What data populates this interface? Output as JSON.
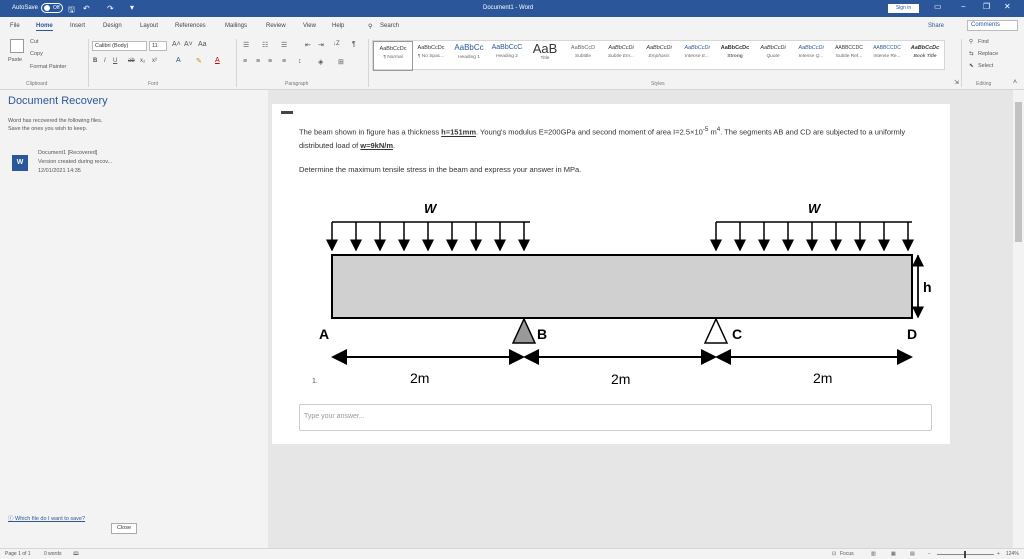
{
  "titlebar": {
    "autosave_label": "AutoSave",
    "autosave_state": "Off",
    "title": "Document1  -  Word",
    "signin": "Sign in",
    "save_icon": "save-icon",
    "undo_icon": "undo-icon",
    "redo_icon": "redo-icon",
    "customize_icon": "customize-qat-icon",
    "display_icon": "ribbon-display-icon",
    "min": "−",
    "restore": "❐",
    "close": "✕"
  },
  "tabs": [
    "File",
    "Home",
    "Insert",
    "Design",
    "Layout",
    "References",
    "Mailings",
    "Review",
    "View",
    "Help"
  ],
  "search_label": "Search",
  "share_label": "Share",
  "comments_label": "Comments",
  "ribbon": {
    "clipboard": {
      "paste": "Paste",
      "cut": "Cut",
      "copy": "Copy",
      "format_painter": "Format Painter",
      "label": "Clipboard"
    },
    "font": {
      "font_name": "Calibri (Body)",
      "font_size": "11",
      "label": "Font"
    },
    "paragraph": {
      "label": "Paragraph"
    },
    "styles": {
      "label": "Styles",
      "items": [
        {
          "sample": "AaBbCcDc",
          "name": "¶ Normal"
        },
        {
          "sample": "AaBbCcDc",
          "name": "¶ No Spac..."
        },
        {
          "sample": "AaBbCc",
          "name": "Heading 1"
        },
        {
          "sample": "AaBbCcC",
          "name": "Heading 2"
        },
        {
          "sample": "AaB",
          "name": "Title"
        },
        {
          "sample": "AaBbCcD",
          "name": "Subtitle"
        },
        {
          "sample": "AaBbCcDi",
          "name": "Subtle Em..."
        },
        {
          "sample": "AaBbCcDi",
          "name": "Emphasis"
        },
        {
          "sample": "AaBbCcDi",
          "name": "Intense E..."
        },
        {
          "sample": "AaBbCcDc",
          "name": "Strong"
        },
        {
          "sample": "AaBbCcDi",
          "name": "Quote"
        },
        {
          "sample": "AaBbCcDi",
          "name": "Intense Q..."
        },
        {
          "sample": "AABBCCDC",
          "name": "Subtle Ref..."
        },
        {
          "sample": "AABBCCDC",
          "name": "Intense Re..."
        },
        {
          "sample": "AaBbCcDc",
          "name": "Book Title"
        }
      ]
    },
    "editing": {
      "find": "Find",
      "replace": "Replace",
      "select": "Select",
      "label": "Editing"
    }
  },
  "recovery": {
    "title": "Document Recovery",
    "line1": "Word has recovered the following files.",
    "line2": "Save the ones you wish to keep.",
    "doc_name": "Document1  [Recovered]",
    "doc_desc": "Version created during recov...",
    "doc_time": "12/01/2021 14:35",
    "help_link": "Which file do I want to save?",
    "close": "Close"
  },
  "question": {
    "text_1": "The beam shown in figure has a thickness ",
    "thickness": "h=151mm",
    "text_2": ". Young's modulus E=200GPa and second moment of area I=2.5×10",
    "exp1": "-5",
    "text_3": " m",
    "exp2": "4",
    "text_4": ". The segments AB and CD are subjected to a uniformly distributed load of ",
    "load": "w=9kN/m",
    "text_5": ".",
    "prompt": "Determine the maximum tensile stress in the beam and express your answer in MPa.",
    "number": "1.",
    "answer_placeholder": "Type your answer..."
  },
  "figure": {
    "load_left": "W",
    "load_right": "W",
    "pt_a": "A",
    "pt_b": "B",
    "pt_c": "C",
    "pt_d": "D",
    "thickness": "h",
    "dim1": "2m",
    "dim2": "2m",
    "dim3": "2m"
  },
  "status": {
    "page": "Page 1 of 1",
    "words": "0 words",
    "focus": "Focus",
    "zoom": "124%"
  }
}
